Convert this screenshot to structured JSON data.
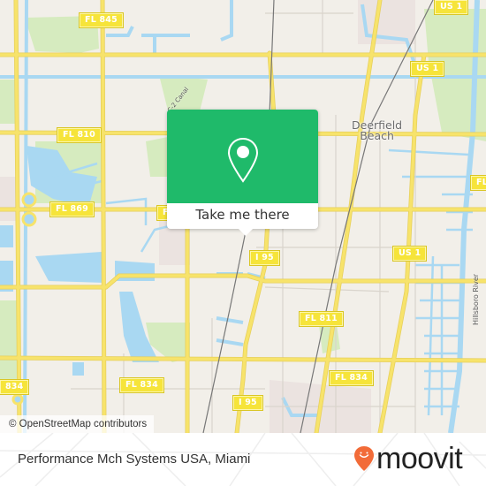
{
  "map": {
    "attribution": "© OpenStreetMap contributors",
    "places": [
      {
        "label_line1": "Deerfield",
        "label_line2": "Beach"
      }
    ],
    "water_labels": {
      "river": "Hillsboro River",
      "canal": "C-2 Canal"
    },
    "road_shields": [
      {
        "label": "FL 845"
      },
      {
        "label": "US 1"
      },
      {
        "label": "US 1"
      },
      {
        "label": "FL 810"
      },
      {
        "label": "FL 869"
      },
      {
        "label": "F"
      },
      {
        "label": "FL"
      },
      {
        "label": "I 95"
      },
      {
        "label": "US 1"
      },
      {
        "label": "FL 811"
      },
      {
        "label": "834"
      },
      {
        "label": "FL 834"
      },
      {
        "label": "FL 834"
      },
      {
        "label": "I 95"
      }
    ],
    "colors": {
      "land": "#f2efe9",
      "road": "#f7e36b",
      "water": "#a9d8f2",
      "park": "#cde8b0",
      "popup": "#1fba6a"
    }
  },
  "popup": {
    "cta_label": "Take me there",
    "icon": "map-pin-icon"
  },
  "footer": {
    "title": "Performance Mch Systems USA, Miami",
    "logo_text": "moovit",
    "logo_icon": "moovit-pin-icon",
    "logo_color": "#f26b38"
  }
}
